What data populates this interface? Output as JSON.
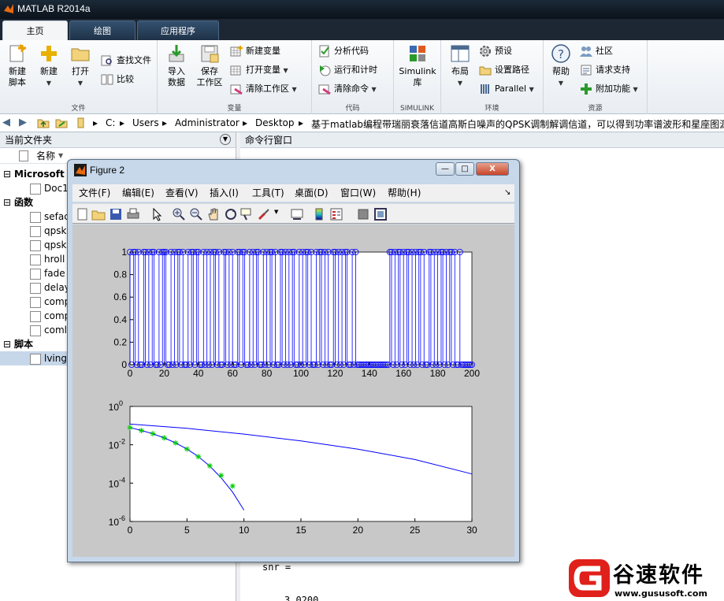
{
  "app": {
    "title": "MATLAB R2014a"
  },
  "tabs": [
    {
      "label": "主页"
    },
    {
      "label": "绘图"
    },
    {
      "label": "应用程序"
    }
  ],
  "ribbon": {
    "file": {
      "group": "文件",
      "new_script": [
        "新建",
        "脚本"
      ],
      "new": "新建",
      "open": "打开",
      "find_files": "查找文件",
      "compare": "比较"
    },
    "variable": {
      "group": "变量",
      "import": [
        "导入",
        "数据"
      ],
      "save_ws": [
        "保存",
        "工作区"
      ],
      "new_var": "新建变量",
      "open_var": "打开变量",
      "clear_ws": "清除工作区"
    },
    "code": {
      "group": "代码",
      "analyze": "分析代码",
      "run_time": "运行和计时",
      "clear_cmd": "清除命令"
    },
    "simulink": {
      "group": "SIMULINK",
      "label": [
        "Simulink",
        "库"
      ]
    },
    "env": {
      "group": "环境",
      "layout": "布局",
      "prefs": "预设",
      "set_path": "设置路径",
      "parallel": "Parallel"
    },
    "resources": {
      "group": "资源",
      "help": "帮助",
      "community": "社区",
      "support": "请求支持",
      "addons": "附加功能"
    }
  },
  "address": {
    "crumbs": [
      "C:",
      "Users",
      "Administrator",
      "Desktop",
      "基于matlab编程带瑞丽衰落信道高斯白噪声的QPSK调制解调信道，可以得到功率谱波形和星座图源"
    ]
  },
  "current_folder": {
    "title": "当前文件夹",
    "col_name": "名称",
    "rows": [
      {
        "label": "Microsoft",
        "kind": "head"
      },
      {
        "label": "Doc1",
        "kind": "file"
      },
      {
        "label": "函数",
        "kind": "head"
      },
      {
        "label": "sefac",
        "kind": "file"
      },
      {
        "label": "qpsk",
        "kind": "file"
      },
      {
        "label": "qpsk",
        "kind": "file"
      },
      {
        "label": "hroll",
        "kind": "file"
      },
      {
        "label": "fade",
        "kind": "file"
      },
      {
        "label": "delay",
        "kind": "file"
      },
      {
        "label": "comp",
        "kind": "file"
      },
      {
        "label": "comp",
        "kind": "file"
      },
      {
        "label": "coml",
        "kind": "file"
      },
      {
        "label": "脚本",
        "kind": "head"
      },
      {
        "label": "lving",
        "kind": "file"
      }
    ]
  },
  "command_window": {
    "title": "命令行窗口",
    "lines": [
      "snr =",
      "3.0200"
    ]
  },
  "figure": {
    "title": "Figure 2",
    "menu": [
      "文件(F)",
      "编辑(E)",
      "查看(V)",
      "插入(I)",
      "工具(T)",
      "桌面(D)",
      "窗口(W)",
      "帮助(H)"
    ],
    "min_glyph": "—",
    "max_glyph": "□",
    "close_glyph": "X"
  },
  "chart_data": [
    {
      "type": "stem",
      "xlim": [
        0,
        200
      ],
      "ylim": [
        0,
        1
      ],
      "xticks": [
        "0",
        "20",
        "40",
        "60",
        "80",
        "100",
        "120",
        "140",
        "160",
        "180",
        "200"
      ],
      "yticks": [
        "0",
        "0.2",
        "0.4",
        "0.6",
        "0.8",
        "1"
      ],
      "color": "#0000ff",
      "values": [
        1,
        0,
        1,
        1,
        0,
        1,
        0,
        0,
        1,
        1,
        0,
        1,
        0,
        1,
        1,
        0,
        0,
        1,
        0,
        1,
        1,
        1,
        0,
        0,
        1,
        0,
        1,
        0,
        1,
        1,
        0,
        1,
        0,
        0,
        1,
        0,
        1,
        1,
        0,
        1,
        1,
        0,
        0,
        1,
        0,
        1,
        0,
        1,
        0,
        1,
        1,
        0,
        1,
        0,
        0,
        1,
        1,
        0,
        1,
        0,
        1,
        0,
        0,
        1,
        1,
        0,
        1,
        1,
        0,
        0,
        1,
        0,
        1,
        0,
        1,
        1,
        0,
        0,
        1,
        0,
        1,
        0,
        1,
        1,
        0,
        1,
        0,
        0,
        1,
        1,
        0,
        1,
        0,
        1,
        0,
        1,
        1,
        0,
        0,
        1,
        0,
        1,
        0,
        1,
        1,
        0,
        1,
        0,
        0,
        1,
        0,
        1,
        1,
        0,
        1,
        0,
        1,
        0,
        0,
        1,
        1,
        0,
        1,
        0,
        1,
        0,
        1,
        1,
        0,
        0,
        1,
        0,
        1,
        0,
        0,
        0,
        0,
        0,
        0,
        0,
        0,
        0,
        0,
        0,
        0,
        0,
        0,
        0,
        0,
        0,
        0,
        0,
        1,
        1,
        0,
        1,
        0,
        1,
        1,
        0,
        1,
        0,
        1,
        1,
        0,
        1,
        0,
        1,
        0,
        1,
        1,
        0,
        1,
        0,
        0,
        1,
        1,
        0,
        1,
        0,
        1,
        0,
        1,
        1,
        0,
        1,
        0,
        1,
        1,
        0,
        1,
        0,
        0,
        1,
        0,
        0,
        0,
        0,
        0,
        0,
        0
      ]
    },
    {
      "type": "line",
      "yscale": "log",
      "xlim": [
        0,
        30
      ],
      "ylim": [
        1e-06,
        1
      ],
      "xticks": [
        "0",
        "5",
        "10",
        "15",
        "20",
        "25",
        "30"
      ],
      "yticks": [
        {
          "base": "10",
          "exp": "0"
        },
        {
          "base": "10",
          "exp": "-2"
        },
        {
          "base": "10",
          "exp": "-4"
        },
        {
          "base": "10",
          "exp": "-6"
        }
      ],
      "series": [
        {
          "style": "line",
          "color": "#0000ff",
          "x": [
            0,
            5,
            10,
            15,
            20,
            25,
            30
          ],
          "y": [
            0.12,
            0.072,
            0.036,
            0.0158,
            0.0059,
            0.0017,
            0.0003
          ]
        },
        {
          "style": "line",
          "color": "#0000ff",
          "x": [
            0,
            1,
            2,
            3,
            4,
            5,
            6,
            7,
            8,
            9,
            10
          ],
          "y": [
            0.079,
            0.056,
            0.0375,
            0.0229,
            0.0125,
            0.006,
            0.0024,
            0.00077,
            0.00019,
            3.4e-05,
            3.9e-06
          ]
        },
        {
          "style": "marker",
          "color": "#00cc00",
          "x": [
            0,
            1,
            2,
            3,
            4,
            5,
            6,
            7,
            8,
            9
          ],
          "y": [
            0.079,
            0.055,
            0.038,
            0.023,
            0.0125,
            0.006,
            0.0024,
            0.0008,
            0.00025,
            7e-05
          ]
        }
      ]
    }
  ],
  "watermark": {
    "text": "谷速软件",
    "url": "www.gususoft.com"
  }
}
